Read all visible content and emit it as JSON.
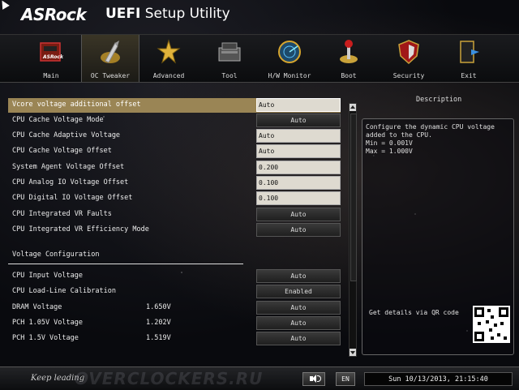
{
  "header": {
    "brand": "ASRock",
    "uefi": "UEFI",
    "subtitle": "Setup Utility"
  },
  "tabs": [
    {
      "label": "Main",
      "icon": "main-icon",
      "active": false
    },
    {
      "label": "OC Tweaker",
      "icon": "rocket-icon",
      "active": true
    },
    {
      "label": "Advanced",
      "icon": "star-icon",
      "active": false
    },
    {
      "label": "Tool",
      "icon": "toolbox-icon",
      "active": false
    },
    {
      "label": "H/W Monitor",
      "icon": "radar-icon",
      "active": false
    },
    {
      "label": "Boot",
      "icon": "joystick-icon",
      "active": false
    },
    {
      "label": "Security",
      "icon": "shield-icon",
      "active": false
    },
    {
      "label": "Exit",
      "icon": "exit-door-icon",
      "active": false
    }
  ],
  "settings": [
    {
      "label": "Vcore voltage additional offset",
      "value": "Auto",
      "style": "sel"
    },
    {
      "label": "CPU Cache Voltage Mode",
      "value": "Auto",
      "style": "dark"
    },
    {
      "label": "CPU Cache Adaptive Voltage",
      "value": "Auto",
      "style": "light"
    },
    {
      "label": "CPU Cache Voltage Offset",
      "value": "Auto",
      "style": "light"
    },
    {
      "label": "System Agent Voltage Offset",
      "value": "0.200",
      "style": "light"
    },
    {
      "label": "CPU Analog IO Voltage Offset",
      "value": "0.100",
      "style": "light"
    },
    {
      "label": "CPU Digital IO Voltage Offset",
      "value": "0.100",
      "style": "light"
    },
    {
      "label": "CPU Integrated VR Faults",
      "value": "Auto",
      "style": "dark"
    },
    {
      "label": "CPU Integrated VR Efficiency Mode",
      "value": "Auto",
      "style": "dark"
    }
  ],
  "section": {
    "title": "Voltage Configuration"
  },
  "voltage_settings": [
    {
      "label": "CPU Input Voltage",
      "reading": "",
      "value": "Auto"
    },
    {
      "label": "CPU Load-Line Calibration",
      "reading": "",
      "value": "Enabled"
    },
    {
      "label": "DRAM Voltage",
      "reading": "1.650V",
      "value": "Auto"
    },
    {
      "label": "PCH 1.05V Voltage",
      "reading": "1.202V",
      "value": "Auto"
    },
    {
      "label": "PCH 1.5V Voltage",
      "reading": "1.519V",
      "value": "Auto"
    }
  ],
  "description": {
    "title": "Description",
    "text": "Configure the dynamic CPU voltage\nadded to the CPU.\nMin = 0.001V\nMax = 1.000V",
    "qr_label": "Get details via QR code"
  },
  "footer": {
    "tagline": "Keep leading",
    "watermark": "OVERCLOCKERS.RU",
    "language": "EN",
    "datetime": "Sun 10/13/2013, 21:15:40"
  },
  "colors": {
    "selected_row": "#9a8555",
    "field_light": "#dedad0",
    "background": "#090a0e"
  }
}
